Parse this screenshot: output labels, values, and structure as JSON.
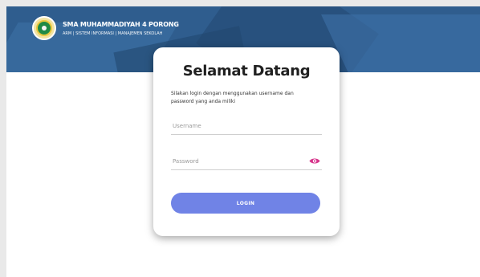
{
  "header": {
    "school_name": "SMA MUHAMMADIYAH 4 PORONG",
    "subtitle": "ARM | SISTEM INFORMASI | MANAJEMEN SEKOLAH",
    "logo_icon": "school-logo-icon"
  },
  "login": {
    "title": "Selamat Datang",
    "description": "Silakan login dengan menggunakan username dan password yang anda miliki",
    "username": {
      "value": "",
      "placeholder": "Username"
    },
    "password": {
      "value": "",
      "placeholder": "Password",
      "toggle_icon": "eye-icon"
    },
    "button_label": "LOGIN"
  },
  "colors": {
    "banner": "#2f5d8e",
    "button": "#7083e6",
    "eye_icon": "#d6338a"
  }
}
